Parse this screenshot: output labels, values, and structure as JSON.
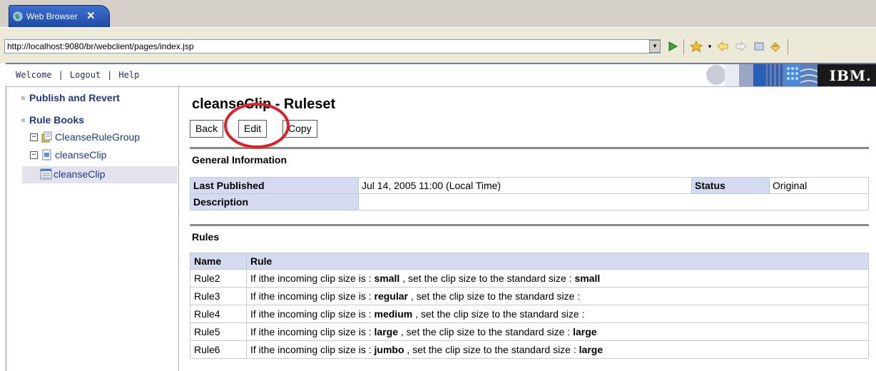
{
  "browser": {
    "tab_title": "Web Browser",
    "close_glyph": "✕",
    "url": "http://localhost:9080/br/webclient/pages/index.jsp",
    "toolbar_icons": [
      "go-icon",
      "favorites-icon",
      "back-icon",
      "forward-icon",
      "stop-icon",
      "refresh-icon"
    ]
  },
  "header": {
    "nav": [
      "Welcome",
      "Logout",
      "Help"
    ],
    "separator": "|",
    "logo": "IBM."
  },
  "sidebar": {
    "publish_revert": "Publish and Revert",
    "rule_books": "Rule Books",
    "tree": [
      {
        "label": "CleanseRuleGroup",
        "toggle": "−"
      },
      {
        "label": "cleanseClip",
        "toggle": "−"
      },
      {
        "label": "cleanseClip",
        "selected": true
      }
    ]
  },
  "main": {
    "title": "cleanseClip - Ruleset",
    "buttons": {
      "back": "Back",
      "edit": "Edit",
      "copy": "Copy"
    },
    "general_info_title": "General Information",
    "general_info": {
      "last_published_label": "Last Published",
      "last_published_value": "Jul 14, 2005 11:00 (Local Time)",
      "status_label": "Status",
      "status_value": "Original",
      "description_label": "Description",
      "description_value": ""
    },
    "rules_title": "Rules",
    "rules_table": {
      "headers": [
        "Name",
        "Rule"
      ],
      "rows": [
        {
          "name": "Rule2",
          "prefix": "If ithe incoming clip size is : ",
          "input": "small",
          "middle": " , set the clip size to the standard size : ",
          "output": "small"
        },
        {
          "name": "Rule3",
          "prefix": "If ithe incoming clip size is : ",
          "input": "regular",
          "middle": " , set the clip size to the standard size : ",
          "output": ""
        },
        {
          "name": "Rule4",
          "prefix": "If ithe incoming clip size is : ",
          "input": "medium",
          "middle": " , set the clip size to the standard size : ",
          "output": ""
        },
        {
          "name": "Rule5",
          "prefix": "If ithe incoming clip size is : ",
          "input": "large",
          "middle": " , set the clip size to the standard size : ",
          "output": "large"
        },
        {
          "name": "Rule6",
          "prefix": "If ithe incoming clip size is : ",
          "input": "jumbo",
          "middle": " , set the clip size to the standard size : ",
          "output": "large"
        }
      ]
    }
  },
  "colors": {
    "tab_blue": "#2450b5",
    "link_blue": "#1d3a8a",
    "header_cell": "#d4daf0",
    "highlight_circle": "#e41e26"
  }
}
